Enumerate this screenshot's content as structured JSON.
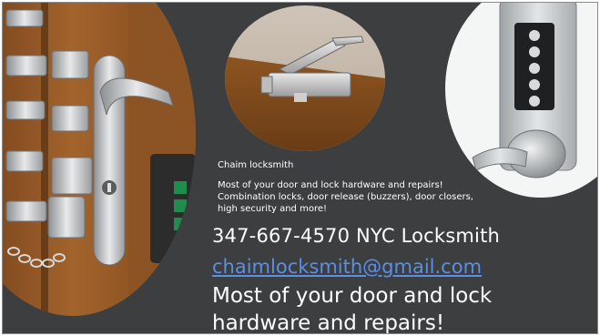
{
  "card": {
    "name": "Chaim locksmith",
    "lines": [
      "Most of your door and lock hardware and repairs!",
      "Combination locks, door release (buzzers), door closers,",
      "high security and more!"
    ],
    "phone": "347-667-4570 NYC Locksmith",
    "email": "chaimlocksmith@gmail.com",
    "tagline_line1": "Most of your door and lock",
    "tagline_line2": "hardware and repairs!"
  },
  "images": {
    "left": "door-hardware-photo",
    "center": "door-closer-photo",
    "right": "keypad-lock-photo"
  },
  "colors": {
    "background": "#3d3e3f",
    "text": "#ffffff",
    "link": "#5b8fe6"
  }
}
